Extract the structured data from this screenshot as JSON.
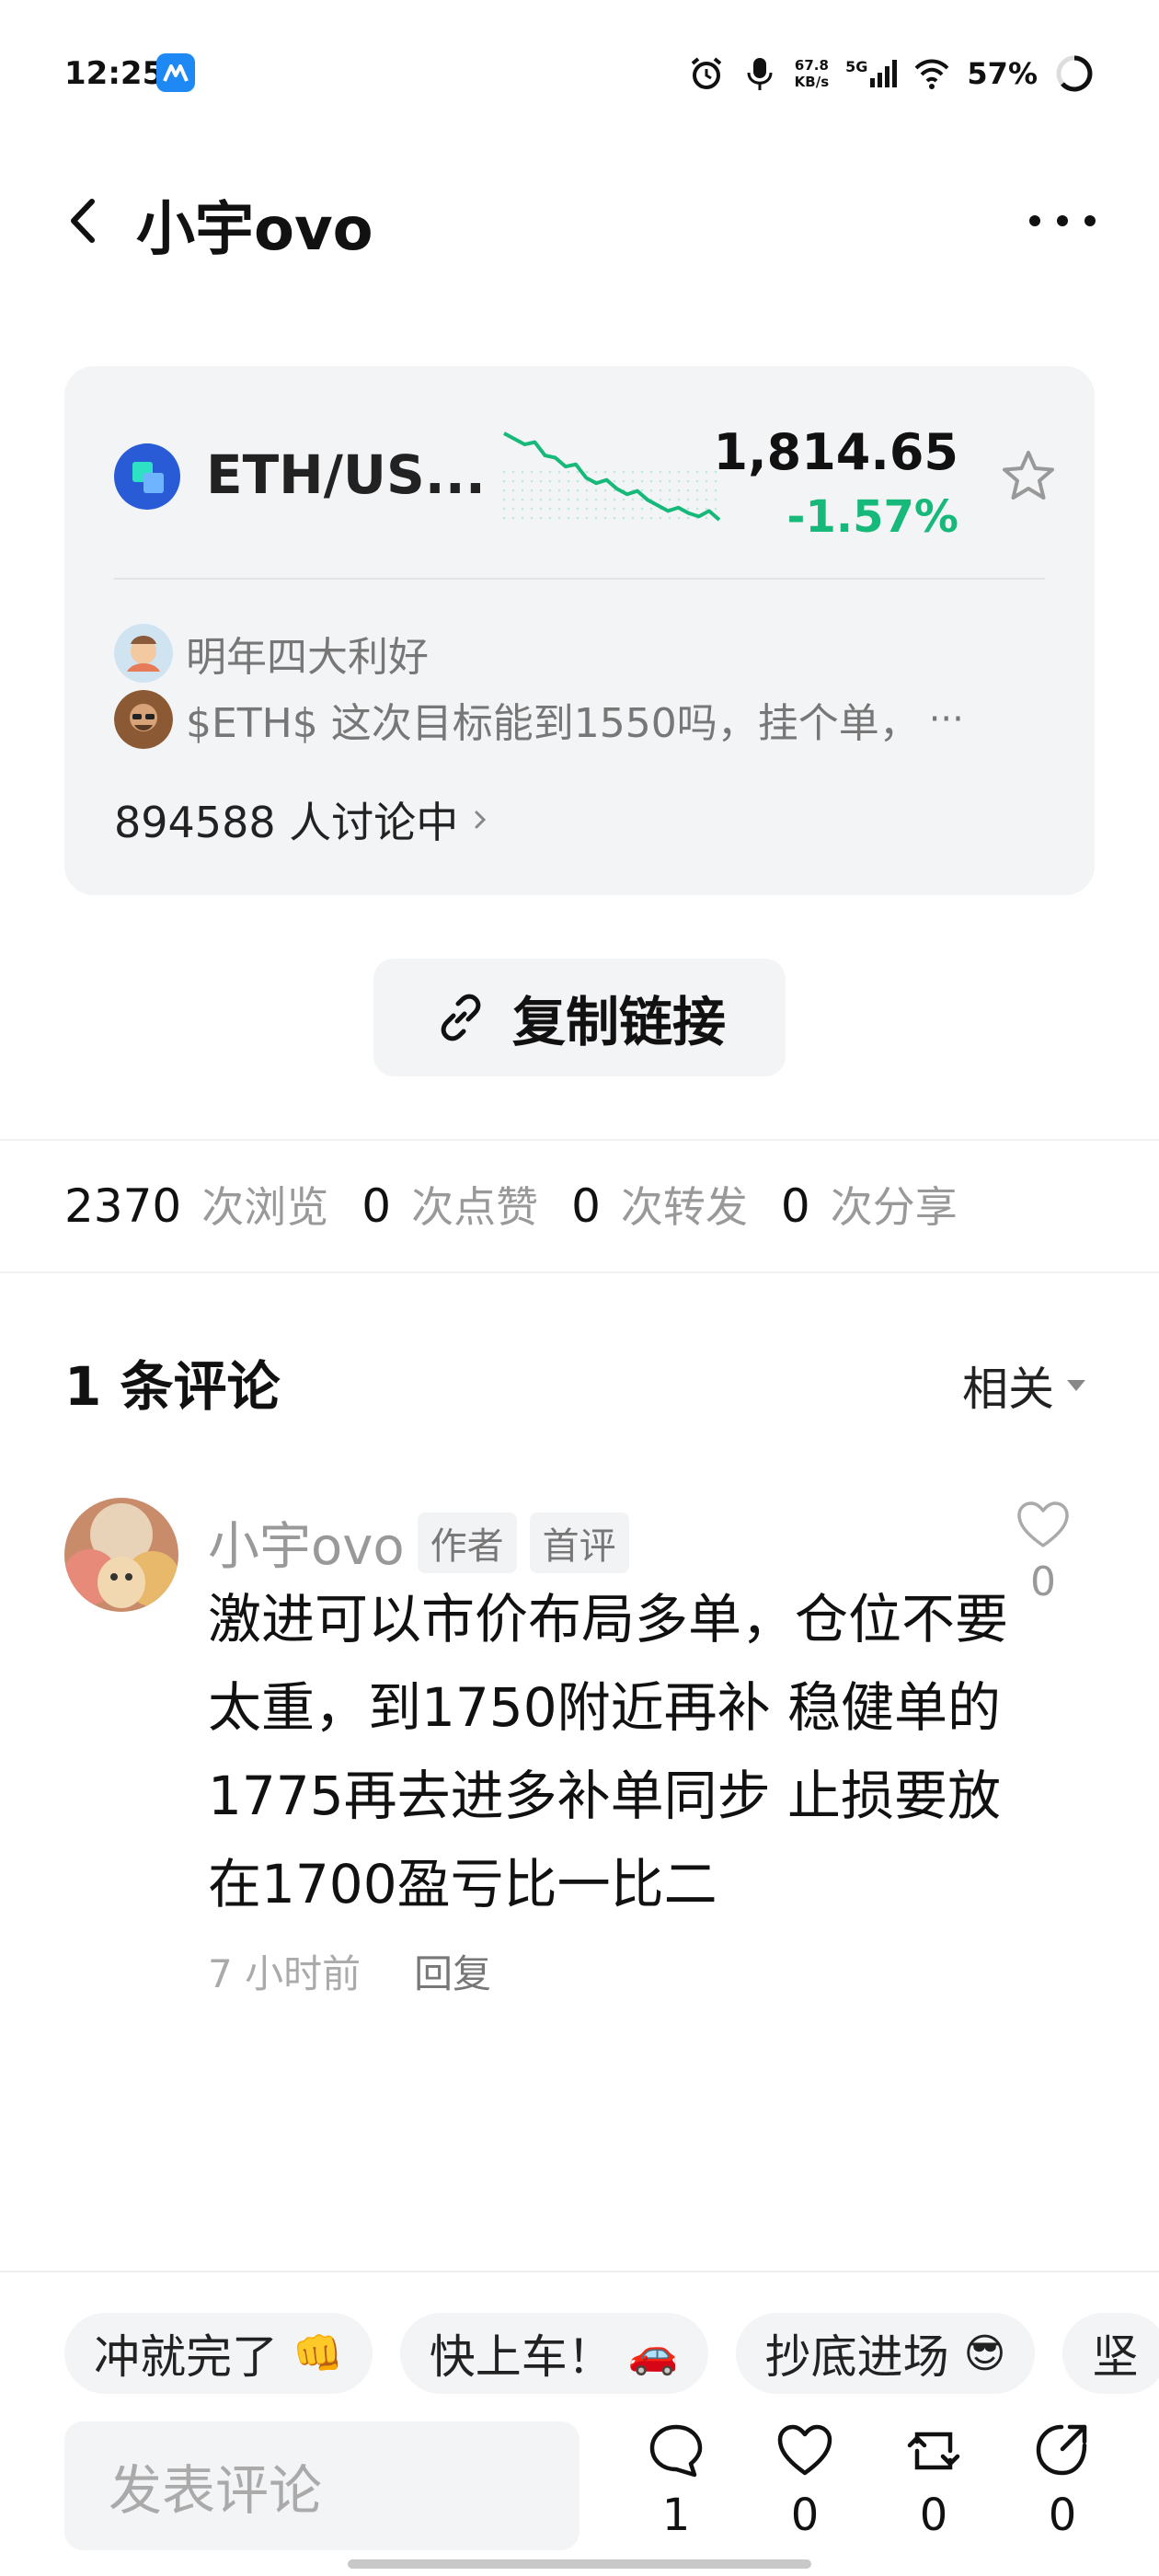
{
  "status_bar": {
    "time": "12:25",
    "net_speed_value": "67.8",
    "net_speed_unit": "KB/s",
    "signal": "5G",
    "battery": "57%",
    "icons": [
      "alarm-icon",
      "mic-icon",
      "signal-icon",
      "wifi-icon",
      "battery-ring-icon"
    ]
  },
  "header": {
    "title": "小宇ovo",
    "back_icon": "chevron-left-icon",
    "more_icon": "more-dots-icon"
  },
  "ticker": {
    "pair": "ETH/US...",
    "price": "1,814.65",
    "change": "-1.57%",
    "change_color": "#16b979",
    "sparkline_trend": [
      1.0,
      0.95,
      0.9,
      0.92,
      0.8,
      0.78,
      0.7,
      0.72,
      0.6,
      0.55,
      0.58,
      0.5,
      0.45,
      0.48,
      0.4,
      0.35,
      0.3,
      0.33,
      0.28,
      0.25,
      0.3,
      0.22
    ],
    "discussions": [
      {
        "text": "明年四大利好"
      },
      {
        "text": "$ETH$  这次目标能到1550吗，挂个单，",
        "ellipsis": "···"
      }
    ],
    "discussion_count": "894588 人讨论中"
  },
  "copy_link": {
    "label": "复制链接"
  },
  "stats": {
    "views": "2370",
    "views_label": "次浏览",
    "likes": "0",
    "likes_label": "次点赞",
    "reposts": "0",
    "reposts_label": "次转发",
    "shares": "0",
    "shares_label": "次分享"
  },
  "comments": {
    "title": "1 条评论",
    "sort_label": "相关",
    "items": [
      {
        "author": "小宇ovo",
        "tags": [
          "作者",
          "首评"
        ],
        "text": "激进可以市价布局多单，仓位不要太重，到1750附近再补 稳健单的1775再去进多补单同步 止损要放在1700盈亏比一比二",
        "time": "7 小时前",
        "reply_label": "回复",
        "likes": "0"
      }
    ]
  },
  "quick_replies": [
    {
      "text": "冲就完了",
      "emoji": "👊"
    },
    {
      "text": "快上车！",
      "emoji": "🚗"
    },
    {
      "text": "抄底进场",
      "emoji": "😎"
    },
    {
      "text": "坚",
      "emoji": ""
    }
  ],
  "bottom_bar": {
    "input_placeholder": "发表评论",
    "comment_count": "1",
    "like_count": "0",
    "repost_count": "0",
    "share_count": "0"
  }
}
